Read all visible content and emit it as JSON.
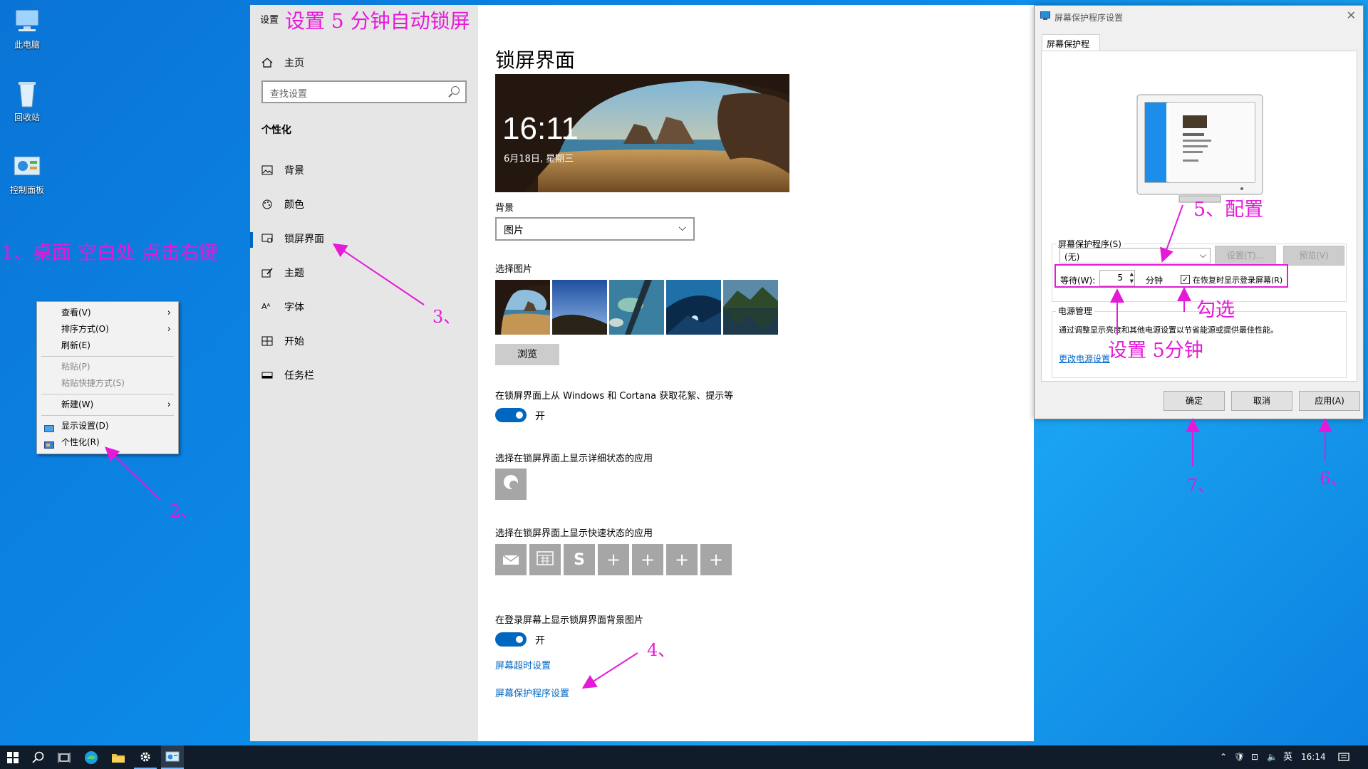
{
  "desktop": {
    "icons": [
      {
        "label": "此电脑",
        "icon": "computer-icon"
      },
      {
        "label": "回收站",
        "icon": "recycle-bin-icon"
      },
      {
        "label": "控制面板",
        "icon": "control-panel-icon"
      }
    ]
  },
  "context_menu": {
    "items": [
      {
        "label": "查看(V)",
        "submenu": true,
        "disabled": false
      },
      {
        "label": "排序方式(O)",
        "submenu": true,
        "disabled": false
      },
      {
        "label": "刷新(E)",
        "submenu": false,
        "disabled": false
      },
      {
        "label": "粘贴(P)",
        "submenu": false,
        "disabled": true
      },
      {
        "label": "粘贴快捷方式(S)",
        "submenu": false,
        "disabled": true
      },
      {
        "label": "新建(W)",
        "submenu": true,
        "disabled": false
      },
      {
        "label": "显示设置(D)",
        "submenu": false,
        "disabled": false
      },
      {
        "label": "个性化(R)",
        "submenu": false,
        "disabled": false
      }
    ]
  },
  "settings": {
    "window_title": "设置",
    "home_label": "主页",
    "search_placeholder": "查找设置",
    "section_label": "个性化",
    "nav": [
      {
        "label": "背景",
        "icon": "image-icon"
      },
      {
        "label": "颜色",
        "icon": "palette-icon"
      },
      {
        "label": "锁屏界面",
        "icon": "lock-screen-icon",
        "selected": true
      },
      {
        "label": "主题",
        "icon": "theme-brush-icon"
      },
      {
        "label": "字体",
        "icon": "font-icon"
      },
      {
        "label": "开始",
        "icon": "start-grid-icon"
      },
      {
        "label": "任务栏",
        "icon": "taskbar-icon"
      }
    ],
    "page_title": "锁屏界面",
    "preview_time": "16:11",
    "preview_date": "6月18日, 星期三",
    "background_label": "背景",
    "background_value": "图片",
    "choose_picture_label": "选择图片",
    "browse_label": "浏览",
    "fun_facts_label": "在锁屏界面上从 Windows 和 Cortana 获取花絮、提示等",
    "fun_facts_state": "开",
    "detailed_status_label": "选择在锁屏界面上显示详细状态的应用",
    "quick_status_label": "选择在锁屏界面上显示快速状态的应用",
    "quick_apps": [
      "mail-icon",
      "calendar-icon",
      "skype-icon",
      "plus-icon",
      "plus-icon",
      "plus-icon",
      "plus-icon"
    ],
    "signin_bg_label": "在登录屏幕上显示锁屏界面背景图片",
    "signin_bg_state": "开",
    "screen_timeout_link": "屏幕超时设置",
    "screensaver_link": "屏幕保护程序设置"
  },
  "screensaver_dialog": {
    "title": "屏幕保护程序设置",
    "tab_label": "屏幕保护程序",
    "group_label": "屏幕保护程序(S)",
    "selected_saver": "(无)",
    "settings_button": "设置(T)...",
    "preview_button": "预览(V)",
    "wait_label": "等待(W):",
    "wait_value": "5",
    "minutes_label": "分钟",
    "resume_checkbox_label": "在恢复时显示登录屏幕(R)",
    "resume_checked": true,
    "power_group_label": "电源管理",
    "power_desc": "通过调整显示亮度和其他电源设置以节省能源或提供最佳性能。",
    "power_link": "更改电源设置",
    "ok_button": "确定",
    "cancel_button": "取消",
    "apply_button": "应用(A)"
  },
  "annotations": {
    "top_title": "设置 5 分钟自动锁屏",
    "step1": "1、桌面 空白处 点击右键",
    "step2": "2、",
    "step3": "3、",
    "step4": "4、",
    "step5": "5、配置",
    "check_note": "勾选",
    "wait_note": "设置 5分钟",
    "step6": "6、",
    "step7": "7、",
    "color": "#e51ad8"
  },
  "taskbar": {
    "left_icons": [
      "windows-start-icon",
      "search-icon",
      "task-view-icon",
      "edge-icon",
      "file-explorer-icon",
      "settings-gear-icon",
      "control-panel-icon"
    ],
    "ime": "英",
    "clock": "16:14"
  }
}
